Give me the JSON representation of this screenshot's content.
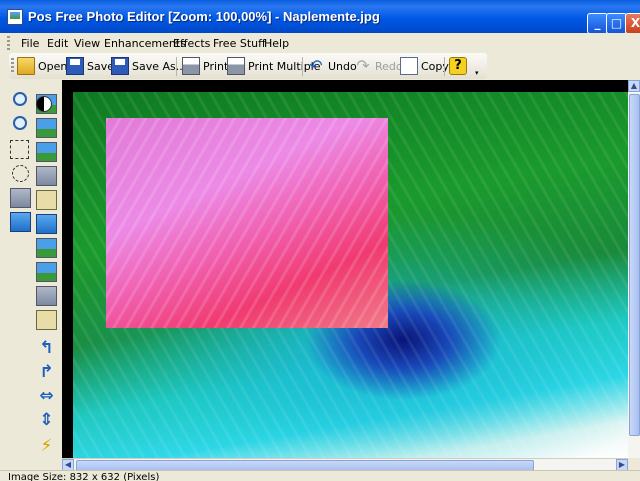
{
  "window": {
    "title": "Pos Free Photo Editor [Zoom: 100,00%] - Naplemente.jpg",
    "minimize_glyph": "_",
    "maximize_glyph": "□",
    "close_glyph": "X"
  },
  "menu": {
    "items": [
      "File",
      "Edit",
      "View",
      "Enhancements",
      "Effects",
      "Free Stuff",
      "Help"
    ]
  },
  "toolbar": {
    "open": "Open",
    "save": "Save",
    "save_as": "Save As...",
    "print": "Print",
    "print_multiple": "Print Multiple",
    "undo": "Undo",
    "redo": "Redo",
    "copy": "Copy",
    "help_glyph": "?"
  },
  "tools": {
    "left_column": [
      "zoom-in-icon",
      "zoom-out-icon",
      "rectangle-select-icon",
      "ellipse-select-icon",
      "crop-icon",
      "monitor-icon"
    ],
    "right_column": [
      "image-icon",
      "contrast-icon",
      "landscape-icon",
      "landscape-icon",
      "resize-icon",
      "add-person-icon",
      "picture-frame-icon",
      "landscape-icon",
      "landscape-icon",
      "grayscale-icon",
      "portrait-icon",
      "rotate-left-icon",
      "rotate-right-icon",
      "flip-horizontal-icon",
      "flip-vertical-icon",
      "lightning-icon"
    ]
  },
  "status": {
    "text": "Image Size: 832 x 632 (Pixels)"
  },
  "colors": {
    "titlebar": "#0058e6",
    "chrome": "#ece9d8",
    "canvas_bg": "#000000"
  }
}
